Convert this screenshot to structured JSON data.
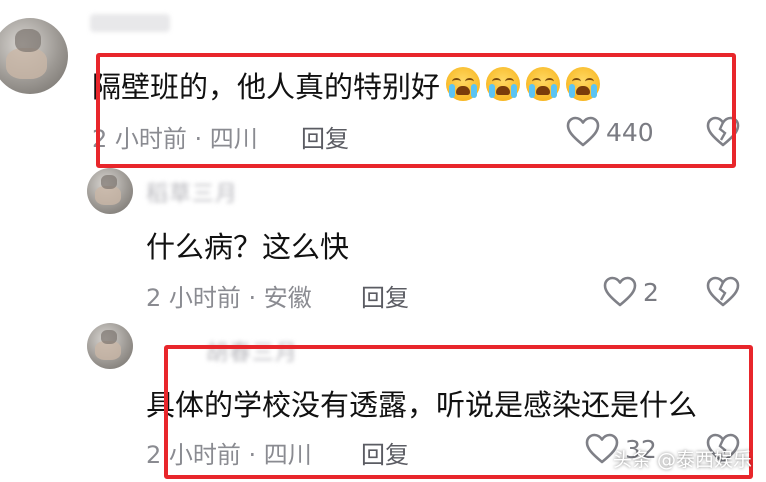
{
  "comments": [
    {
      "text": "隔壁班的，他人真的特别好",
      "emoji": [
        "crying-face",
        "crying-face",
        "crying-face",
        "crying-face"
      ],
      "meta": "2 小时前 · 四川",
      "reply_label": "回复",
      "likes": "440"
    },
    {
      "nickname": "稻草三月",
      "text": "什么病？这么快",
      "meta": "2 小时前 · 安徽",
      "reply_label": "回复",
      "likes": "2"
    },
    {
      "nickname": "胡春三月",
      "text": "具体的学校没有透露，听说是感染还是什么",
      "meta": "2 小时前 · 四川",
      "reply_label": "回复",
      "likes": "32"
    }
  ],
  "watermark": "头条 @泰西娱乐",
  "colors": {
    "highlight": "#e8262b",
    "meta": "#8a8b91",
    "text": "#111111"
  }
}
